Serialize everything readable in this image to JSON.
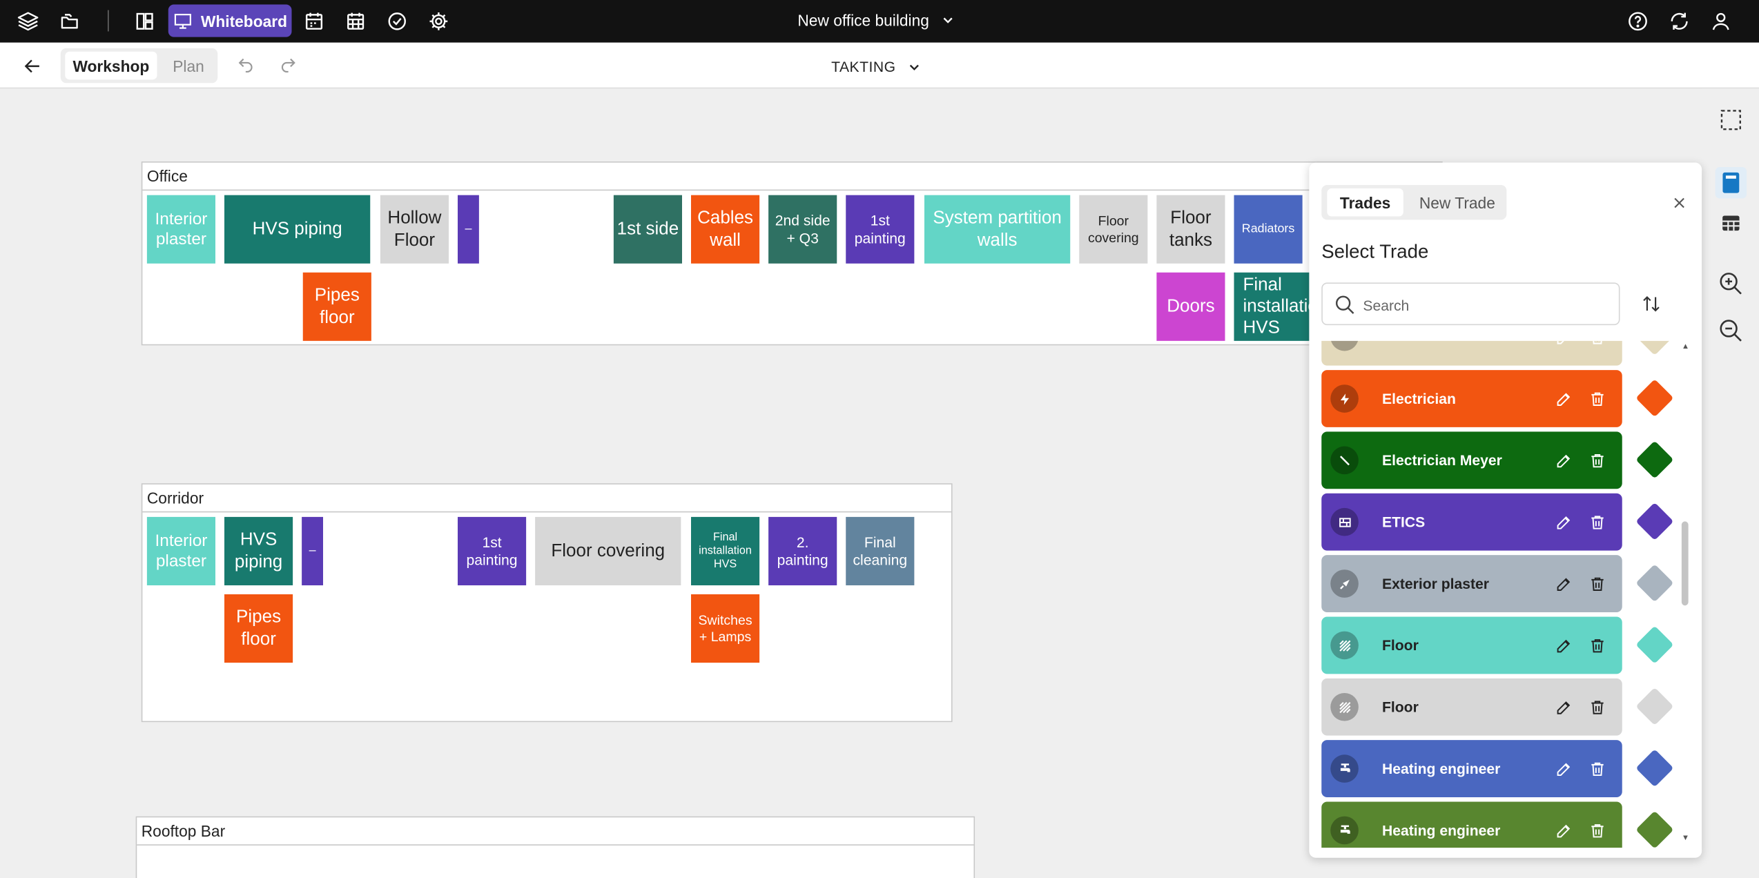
{
  "topbar": {
    "whiteboard_label": "Whiteboard",
    "project_name": "New office building",
    "icons": [
      "layers-icon",
      "folder-icon",
      "dashboard-icon",
      "presentation-icon",
      "calendar-icon",
      "calendar-grid-icon",
      "check-circle-icon",
      "gear-icon",
      "help-icon",
      "refresh-icon",
      "user-icon"
    ]
  },
  "toolbar": {
    "tab_workshop": "Workshop",
    "tab_plan": "Plan",
    "view_selector": "TAKTING"
  },
  "areas": [
    {
      "title": "Office",
      "cards": [
        {
          "label": "Interior plaster",
          "color": "#63d5c6"
        },
        {
          "label": "HVS piping",
          "color": "#187a6e"
        },
        {
          "label": "Hollow Floor",
          "color": "#d7d7d7"
        },
        {
          "label": "–",
          "color": "#5a3bb5"
        },
        {
          "label": "1st side",
          "color": "#2f7163"
        },
        {
          "label": "Cables wall",
          "color": "#f25511"
        },
        {
          "label": "2nd side + Q3",
          "color": "#2f7163"
        },
        {
          "label": "1st painting",
          "color": "#5a3bb5"
        },
        {
          "label": "System partition walls",
          "color": "#63d5c6"
        },
        {
          "label": "Floor covering",
          "color": "#d7d7d7"
        },
        {
          "label": "Floor tanks",
          "color": "#d7d7d7"
        },
        {
          "label": "Radiators",
          "color": "#4a67c0"
        },
        {
          "label": "Pipes floor",
          "color": "#f25511"
        },
        {
          "label": "Doors",
          "color": "#cc45d1"
        },
        {
          "label": "Final installation HVS",
          "color": "#187a6e"
        }
      ]
    },
    {
      "title": "Corridor",
      "cards": [
        {
          "label": "Interior plaster",
          "color": "#63d5c6"
        },
        {
          "label": "HVS piping",
          "color": "#187a6e"
        },
        {
          "label": "–",
          "color": "#5a3bb5"
        },
        {
          "label": "1st painting",
          "color": "#5a3bb5"
        },
        {
          "label": "Floor covering",
          "color": "#d7d7d7"
        },
        {
          "label": "Final installation HVS",
          "color": "#187a6e"
        },
        {
          "label": "2. painting",
          "color": "#5a3bb5"
        },
        {
          "label": "Final cleaning",
          "color": "#62849e"
        },
        {
          "label": "Pipes floor",
          "color": "#f25511"
        },
        {
          "label": "Switches + Lamps",
          "color": "#f25511"
        }
      ]
    },
    {
      "title": "Rooftop Bar",
      "cards": []
    }
  ],
  "panel": {
    "tab_trades": "Trades",
    "tab_new_trade": "New Trade",
    "title": "Select Trade",
    "search_placeholder": "Search",
    "trades": [
      {
        "name": "",
        "color": "#e3d9bb",
        "text_color": "#ffffff",
        "icon": "trade-icon"
      },
      {
        "name": "Electrician",
        "color": "#f25511",
        "text_color": "#ffffff",
        "icon": "lightning-icon"
      },
      {
        "name": "Electrician Meyer",
        "color": "#0d6a10",
        "text_color": "#ffffff",
        "icon": "screwdriver-icon"
      },
      {
        "name": "ETICS",
        "color": "#5a3bb5",
        "text_color": "#ffffff",
        "icon": "brick-wall-icon"
      },
      {
        "name": "Exterior plaster",
        "color": "#a9b4bf",
        "text_color": "#222222",
        "icon": "trowel-icon"
      },
      {
        "name": "Floor",
        "color": "#63d5c6",
        "text_color": "#222222",
        "icon": "hatch-icon"
      },
      {
        "name": "Floor",
        "color": "#d7d7d7",
        "text_color": "#222222",
        "icon": "hatch-icon"
      },
      {
        "name": "Heating engineer",
        "color": "#4a67c0",
        "text_color": "#ffffff",
        "icon": "faucet-icon"
      },
      {
        "name": "Heating engineer",
        "color": "#58862f",
        "text_color": "#ffffff",
        "icon": "faucet-icon"
      }
    ]
  }
}
